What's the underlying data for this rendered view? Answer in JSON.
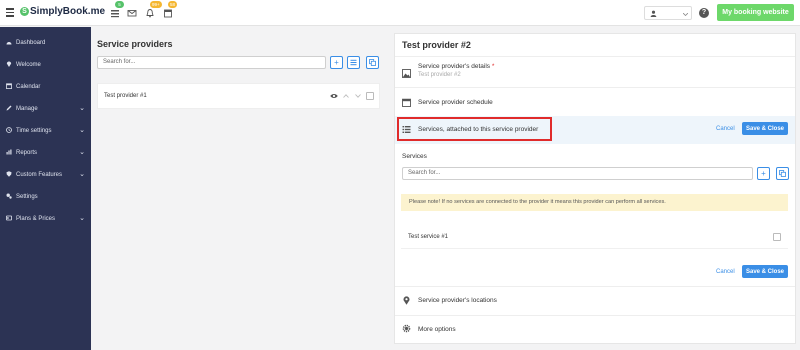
{
  "app": {
    "logo_text": "SimplyBook.me",
    "badges": {
      "tasks": "5",
      "notifications": "99+",
      "calendar": "58"
    },
    "booking_button": "My booking website",
    "help_label": "?"
  },
  "sidebar": {
    "items": [
      {
        "label": "Dashboard",
        "icon": "dashboard-icon",
        "chevron": false
      },
      {
        "label": "Welcome",
        "icon": "map-pin-icon",
        "chevron": false
      },
      {
        "label": "Calendar",
        "icon": "calendar-icon",
        "chevron": false
      },
      {
        "label": "Manage",
        "icon": "pencil-icon",
        "chevron": true
      },
      {
        "label": "Time settings",
        "icon": "clock-icon",
        "chevron": true
      },
      {
        "label": "Reports",
        "icon": "bar-chart-icon",
        "chevron": true
      },
      {
        "label": "Custom Features",
        "icon": "shield-icon",
        "chevron": true
      },
      {
        "label": "Settings",
        "icon": "gears-icon",
        "chevron": false
      },
      {
        "label": "Plans & Prices",
        "icon": "id-card-icon",
        "chevron": true
      }
    ]
  },
  "left": {
    "title": "Service providers",
    "search_placeholder": "Search for...",
    "providers": [
      {
        "name": "Test provider #1"
      }
    ]
  },
  "right": {
    "title": "Test provider #2",
    "details_label": "Service provider's details",
    "details_required": "*",
    "details_placeholder": "Test provider #2",
    "schedule_label": "Service provider schedule",
    "services_section_label": "Services, attached to this service provider",
    "cancel_label": "Cancel",
    "save_label": "Save & Close",
    "services_heading": "Services",
    "services_search_placeholder": "Search for...",
    "note": "Please note! If no services are connected to the provider it means this provider can perform all services.",
    "services": [
      {
        "name": "Test service #1"
      }
    ],
    "locations_label": "Service provider's locations",
    "more_options_label": "More options"
  },
  "colors": {
    "sidebar_bg": "#2c3354",
    "accent": "#3a8ee6",
    "booking_green": "#6dd86a",
    "highlight_red": "#e02b2b",
    "note_bg": "#fcf3cf"
  }
}
